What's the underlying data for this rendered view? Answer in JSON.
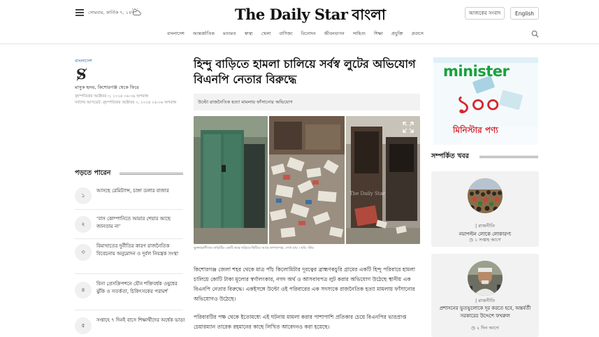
{
  "header": {
    "date": "সোমবার, কার্তিক ৭, ১৪৩২",
    "weather_icon": "partly-cloudy-icon",
    "logo_en": "The Daily Star",
    "logo_bn": "বাংলা",
    "today_news_label": "আজকের সংবাদ",
    "english_label": "English"
  },
  "nav": {
    "items": [
      "বাংলাদেশ",
      "আন্তর্জাতিক",
      "মতামত",
      "স্বাস্থ্য",
      "খেলা",
      "বাণিজ্য",
      "বিনোদন",
      "জীবনযাপন",
      "সাহিত্য",
      "শিক্ষা",
      "প্রযুক্তি",
      "প্রবাসে"
    ]
  },
  "article": {
    "category": "বাংলাদেশ",
    "author": "মাসুক হৃদয়, কিশোরগঞ্জ থেকে ফিরে",
    "published": "বৃহস্পতিবার অক্টোবর ৩, ২০২৪ ০৬:৩৬ অপরাহ্ন",
    "updated": "সর্বশেষ আপডেট: বৃহস্পতিবার অক্টোবর ৩, ২০২৪ ০৬:৩৬ অপরাহ্ন",
    "headline": "হিন্দু বাড়িতে হামলা চালিয়ে সর্বস্ব লুটের অভিযোগ বিএনপি নেতার বিরুদ্ধে",
    "subtitle": "উল্টো রাজনৈতিক হত্যা মামলায় ফাঁসানোর অভিযোগ",
    "caption": "ভুক্তভোগীদের বাড়িটির একটি কক্ষে ছড়িয়ে-ছিটিয়ে আছে কাগজপত্র, দেখা যায় । ছবি: স্টার",
    "watermark": "The Daily Star",
    "paragraphs": [
      "কিশোরগঞ্জ জেলা শহর থেকে মাত্র পাঁচ কিলোমিটার দূরত্বের ব্রাহ্মণকচুরি গ্রামের একটি হিন্দু পরিবারে হামলা চালিয়ে কোটি টাকা মূল্যের স্বর্ণালংকার, নগদ অর্থ ও আসবাবপত্র লুট করার অভিযোগ উঠেছে স্থানীয় এক বিএনপি নেতার বিরুদ্ধে। একইসঙ্গে উল্টো ওই পরিবারের এক সদস্যকে রাজনৈতিক হত্যা মামলায় ফাঁসানোর অভিযোগও উঠেছে।",
      "পরিবারটির পক্ষ থেকে ইতোমধ্যে এই ঘটনায় মামলা করার পাশাপাশি প্রতিকার চেয়ে বিএনপির ভারপ্রাপ্ত চেয়ারম্যান তারেক রহমানের কাছে লিখিত আবেদনও করা হয়েছে।"
    ]
  },
  "read_more": {
    "heading": "পড়তে পারেন",
    "items": [
      {
        "num": "১",
        "text": "আসছে রেমিট্যান্স, চাঙ্গা ডলার বাজার"
      },
      {
        "num": "২",
        "text": "‘বাস কোম্পানিতে আমার শেয়ার আছে জানতাম না’"
      },
      {
        "num": "৩",
        "text": "বিমাখাতের দুর্নীতির কারণ রাজনৈতিক বিবেচনায় অনুমোদন ও দুর্বল নিয়ন্ত্রক সংস্থা"
      },
      {
        "num": "৪",
        "text": "বিনা প্রেসক্রিপশনে যৌন শক্তিবর্ধক ওষুধের ঝুঁকি ও সতর্কতা, চিকিৎসকের পরামর্শ"
      },
      {
        "num": "৫",
        "text": "সপ্তাহে ৭ দিনই বাসে শিক্ষার্থীদের অর্ধেক ভাড়া"
      }
    ]
  },
  "ad": {
    "brand": "minister",
    "number": "১০০",
    "tagline": "মিনিস্টার পণ্য"
  },
  "related": {
    "heading": "সম্পর্কিত খবর",
    "items": [
      {
        "category": "রাজনীতি",
        "title": "নয়াপল্টন লোকে লোকারণ্য",
        "time": "১ সপ্তাহ আগে"
      },
      {
        "category": "রাজনীতি",
        "title": "প্রশাসনের ভুতভুলোকে দূর করতে হবে, অন্তর্বর্তী সরকারের উদ্দেশে ফখরুল",
        "time": "২ দিন আগে"
      }
    ]
  }
}
